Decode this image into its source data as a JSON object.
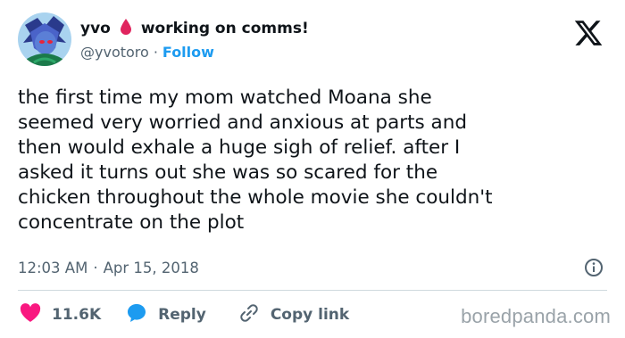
{
  "author": {
    "display_name": "yvo",
    "status": "working on comms!",
    "handle": "@yvotoro",
    "separator": "·",
    "follow_label": "Follow"
  },
  "tweet": {
    "lines": [
      "the first time my mom watched Moana she",
      "seemed very worried and anxious at parts and",
      "then would exhale a huge sigh of relief. after I",
      "asked it turns out she was so scared for the",
      "chicken throughout the whole movie she couldn't",
      "concentrate on the plot"
    ],
    "time": "12:03 AM",
    "separator": "·",
    "date": "Apr 15, 2018"
  },
  "actions": {
    "likes": "11.6K",
    "reply_label": "Reply",
    "copy_label": "Copy link"
  },
  "watermark": "boredpanda.com",
  "colors": {
    "accent": "#1d9bf0",
    "like": "#f91880",
    "drop": "#e0245e",
    "text": "#0f1419",
    "muted": "#536471"
  },
  "icons": [
    "avatar",
    "blood-drop-icon",
    "x-logo-icon",
    "info-icon",
    "heart-icon",
    "reply-bubble-icon",
    "link-icon"
  ]
}
